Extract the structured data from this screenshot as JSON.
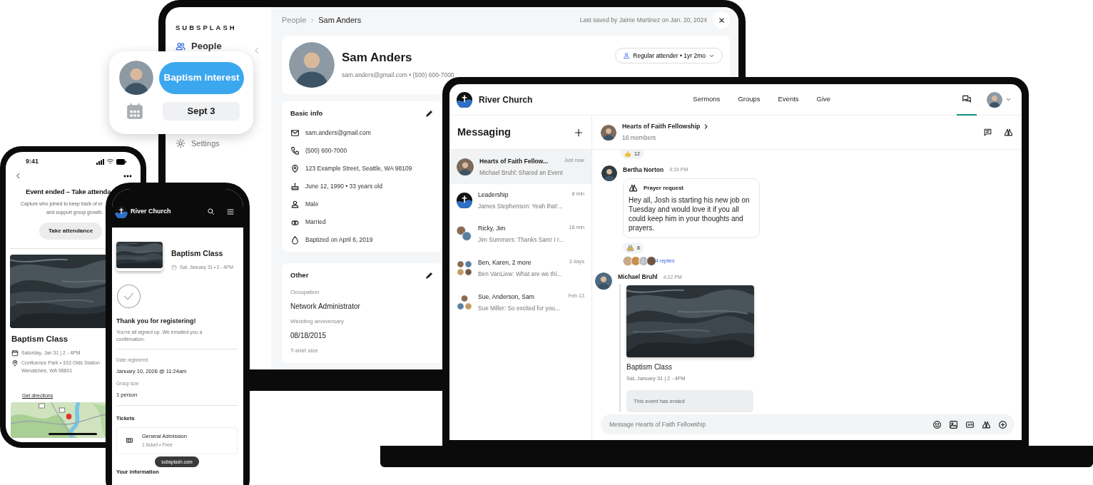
{
  "admin_tablet": {
    "brand": "SUBSPLASH",
    "sidebar": [
      {
        "label": "People",
        "kind": "people",
        "selected": true
      },
      {
        "label": "Settings",
        "kind": "settings",
        "selected": false
      }
    ],
    "breadcrumb": [
      "People",
      "Sam Anders"
    ],
    "last_saved": "Last saved by Jaime Martinez on Jan. 20, 2024",
    "profile": {
      "name": "Sam Anders",
      "contact": "sam.anders@gmail.com • (500) 600-7000",
      "status": "Regular attender • 1yr 2mo"
    },
    "basic_info": {
      "title": "Basic info",
      "items": [
        {
          "kind": "email",
          "text": "sam.anders@gmail.com"
        },
        {
          "kind": "phone",
          "text": "(500) 600-7000"
        },
        {
          "kind": "address",
          "text": "123 Example Street, Seattle, WA 98109"
        },
        {
          "kind": "birthday",
          "text": "June 12, 1990 • 33 years old"
        },
        {
          "kind": "gender",
          "text": "Male"
        },
        {
          "kind": "marital",
          "text": "Married"
        },
        {
          "kind": "baptism",
          "text": "Baptized on April 6, 2019"
        }
      ]
    },
    "other": {
      "title": "Other",
      "fields": [
        {
          "label": "Occupation",
          "value": "Network Administrator"
        },
        {
          "label": "Wedding anniversary",
          "value": "08/18/2015"
        },
        {
          "label": "T-shirt size"
        }
      ]
    }
  },
  "popup": {
    "tag": "Baptism interest",
    "date": "Sept 3"
  },
  "phone_left": {
    "time": "9:41",
    "heading": "Event ended – Take attenda",
    "description": [
      "Capture who joined to keep track of er",
      "and support group growth."
    ],
    "button": "Take attendance",
    "event": {
      "title": "Baptism Class",
      "date": "Saturday, Jan 31 | 2 - 4PM",
      "location": [
        "Confluence Park • 333 Olds Station",
        "Wenatchee, WA 98801"
      ]
    },
    "link": "Get directions"
  },
  "phone_right": {
    "brand": "River Church",
    "event": {
      "title": "Baptism Class",
      "date": "Sat, January 31 • 2 - 4PM"
    },
    "confirmation": {
      "title": "Thank you for registering!",
      "text": "You're all signed up. We emailed you a confirmation."
    },
    "details": [
      {
        "label": "Date registered",
        "value": "January 10, 2026 @ 11:24am"
      },
      {
        "label": "Group size",
        "value": "1 person"
      }
    ],
    "tickets": {
      "title": "Tickets",
      "name": "General Admission",
      "info": "1 ticket • Free"
    },
    "url_pill": "subsplash.com",
    "next_section": "Your information"
  },
  "laptop": {
    "brand": "River Church",
    "nav": [
      "Sermons",
      "Groups",
      "Events",
      "Give"
    ],
    "messages_tab": {
      "selected": true
    },
    "messaging_title": "Messaging",
    "conversations": [
      {
        "name": "Hearts of Faith Fellow...",
        "time": "Just now",
        "preview": "Michael Bruhl: Shared an Event",
        "selected": true
      },
      {
        "kind": "logo",
        "name": "Leadership",
        "time": "8 min",
        "preview": "James Stephenson: Yeah that'...",
        "selected": false
      },
      {
        "kind": "pair",
        "name": "Ricky, Jim",
        "time": "18 min",
        "preview": "Jim Summers: Thanks Sam! I r...",
        "selected": false
      },
      {
        "kind": "quad",
        "name": "Ben, Karen, 2 more",
        "time": "3 days",
        "preview": "Ben VanLiew: What are we thi...",
        "selected": false
      },
      {
        "kind": "trio",
        "name": "Sue, Anderson, Sam",
        "time": "Feb 13",
        "preview": "Sue Miller: So excited for you...",
        "selected": false
      }
    ],
    "chat": {
      "group": "Hearts of Faith Fellowship",
      "members": "16 members",
      "top_reaction_count": "12",
      "messages": [
        {
          "kind": "prayer",
          "author": "Bertha Norton",
          "time": "4:19 PM",
          "label": "Prayer request",
          "text": "Hey all, Josh is starting his new job on Tuesday and would love it if you all could keep him in your thoughts and prayers.",
          "reaction_count": "8",
          "reply_initial": "J",
          "replies": "4 replies"
        },
        {
          "kind": "event",
          "author": "Michael Bruhl",
          "time": "4:22 PM",
          "event_title": "Baptism Class",
          "event_date": "Sat, January 31 | 2 - 4PM",
          "status": "This event has ended"
        }
      ],
      "composer": {
        "placeholder": "Message Hearts of Faith Fellowship"
      }
    }
  }
}
